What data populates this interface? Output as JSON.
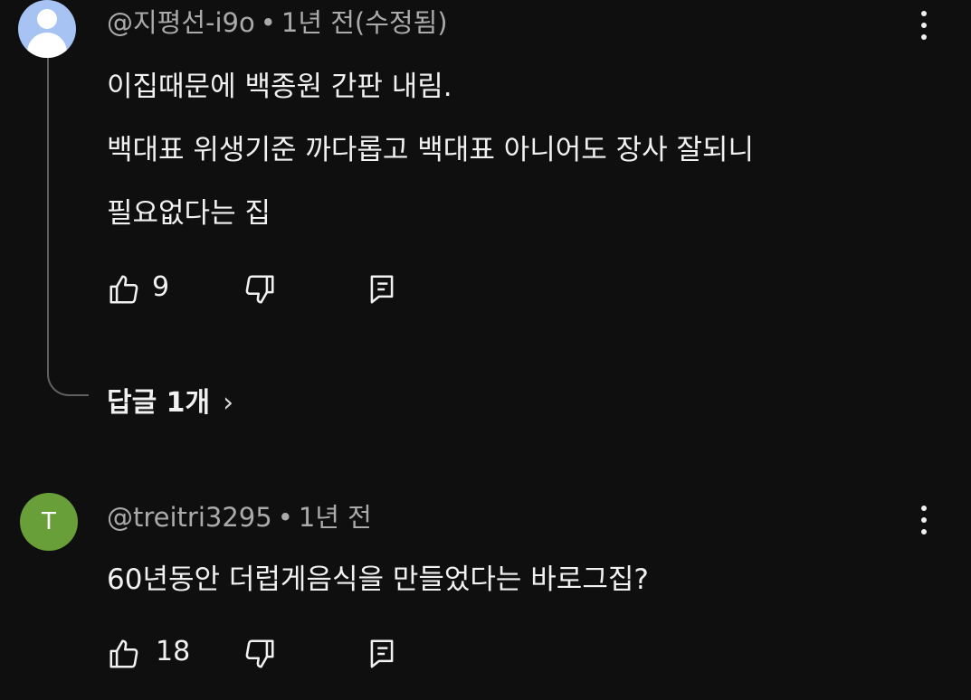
{
  "comments": [
    {
      "author": "@지평선-i9o",
      "time": "1년 전(수정됨)",
      "lines": [
        "이집때문에 백종원 간판 내림.",
        "백대표 위생기준 까다롭고 백대표 아니어도 장사 잘되니",
        "필요없다는 집"
      ],
      "likes": "9",
      "replies_label": "답글 1개",
      "avatar": "default-user-avatar"
    },
    {
      "author": "@treitri3295",
      "time": "1년 전",
      "lines": [
        "60년동안 더럽게음식을 만들었다는 바로그집?"
      ],
      "likes": "18",
      "avatar_letter": "T",
      "avatar_color": "#689f38"
    }
  ],
  "separator": "•",
  "icons": {
    "like": "thumbs-up-icon",
    "dislike": "thumbs-down-icon",
    "reply": "reply-icon",
    "menu": "more-vertical-icon",
    "chevron": "›"
  }
}
